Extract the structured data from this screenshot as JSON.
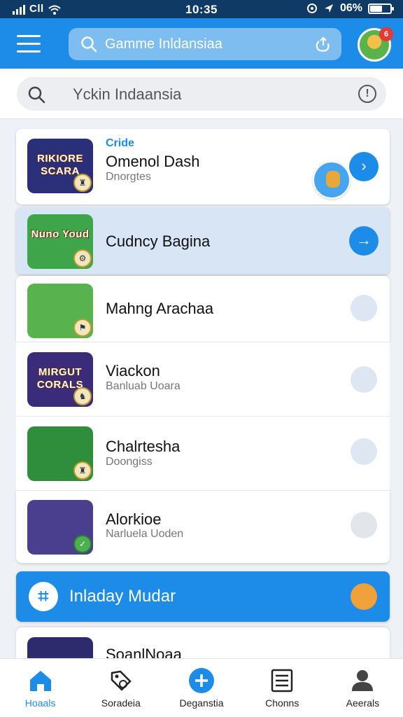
{
  "status_bar": {
    "carrier": "Cll",
    "time": "10:35",
    "battery": "06%",
    "battery_level": 0.6
  },
  "app_bar": {
    "search_text": "Gamme Inldansiaa",
    "avatar_badge": "6"
  },
  "search": {
    "text": "Yckin Indaansia",
    "info": "!"
  },
  "list": {
    "items": [
      {
        "tag": "Cride",
        "title": "Omenol Dash",
        "subtitle": "Dnorgtes",
        "thumb_text": "RIKIORE SCARA",
        "thumb_color": "#2b2f7a",
        "action": "chevron-right"
      },
      {
        "title": "Cudncy Bagina",
        "thumb_text": "Nuno Youd",
        "thumb_color": "#3fa54a",
        "action": "arrow-right"
      },
      {
        "title": "Mahng Arachaa",
        "thumb_text": "",
        "thumb_color": "#58b24e"
      },
      {
        "title": "Viackon",
        "subtitle": "Banluab Uoara",
        "thumb_text": "MIRGUT CORALS",
        "thumb_color": "#3a2c7a"
      },
      {
        "title": "Chalrtesha",
        "subtitle": "Doongiss",
        "thumb_text": "",
        "thumb_color": "#2f8e3c"
      },
      {
        "title": "Alorkioe",
        "subtitle": "Narluela Uoden",
        "thumb_text": "",
        "thumb_color": "#4a3e8e"
      }
    ],
    "peek_title": "SoanlNoaa"
  },
  "banner": {
    "label": "Inladay Mudar",
    "dot_color": "#f0a23a"
  },
  "bottom_nav": [
    {
      "label": "Hoaals",
      "icon": "home-icon",
      "active": true
    },
    {
      "label": "Soradeia",
      "icon": "tag-icon",
      "active": false
    },
    {
      "label": "Deganstia",
      "icon": "add-icon",
      "active": false
    },
    {
      "label": "Chonns",
      "icon": "list-icon",
      "active": false
    },
    {
      "label": "Aeerals",
      "icon": "profile-icon",
      "active": false
    }
  ],
  "colors": {
    "accent": "#1d8be8",
    "status_bar": "#0f3a66",
    "highlight_row": "#d8e5f5"
  }
}
